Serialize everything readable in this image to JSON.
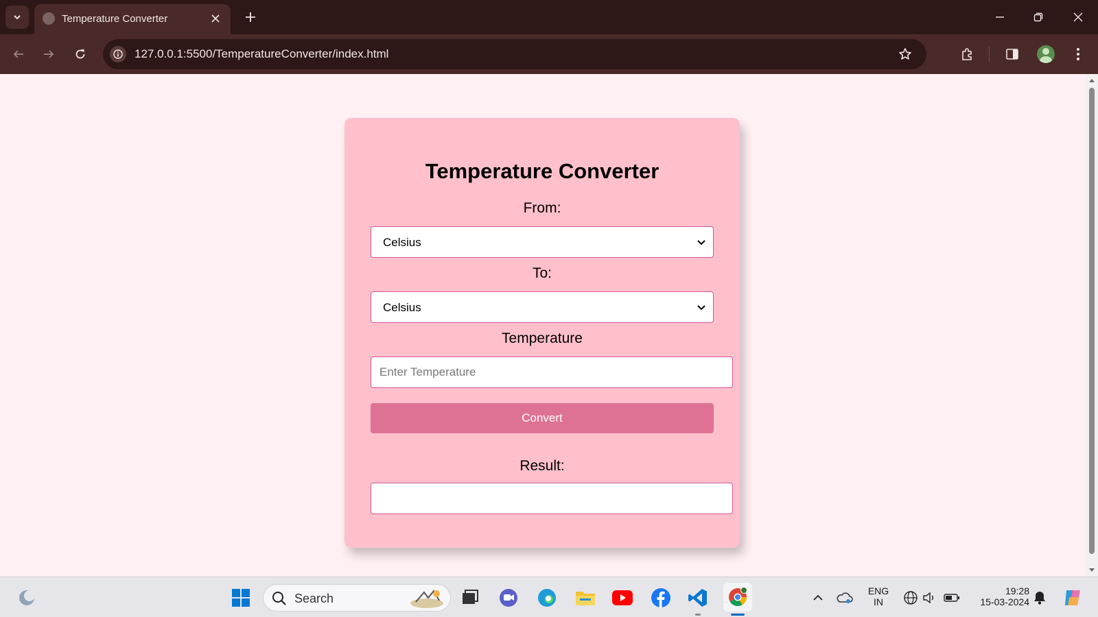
{
  "browser": {
    "tab_title": "Temperature Converter",
    "url": "127.0.0.1:5500/TemperatureConverter/index.html"
  },
  "page": {
    "title": "Temperature Converter",
    "from_label": "From:",
    "from_value": "Celsius",
    "to_label": "To:",
    "to_value": "Celsius",
    "temperature_label": "Temperature",
    "temperature_placeholder": "Enter Temperature",
    "temperature_value": "",
    "convert_label": "Convert",
    "result_label": "Result:",
    "result_value": ""
  },
  "taskbar": {
    "search_placeholder": "Search",
    "lang_line1": "ENG",
    "lang_line2": "IN",
    "time": "19:28",
    "date": "15-03-2024"
  },
  "colors": {
    "page_bg": "#fff0f4",
    "card_bg": "#ffc0cb",
    "input_border": "#d1569a",
    "button_bg": "#de7294",
    "chrome_dark": "#2e1817",
    "chrome_toolbar": "#4a2a28"
  },
  "icons": [
    "tab-search-icon",
    "globe-favicon-icon",
    "close-icon",
    "plus-icon",
    "minimize-icon",
    "restore-icon",
    "back-icon",
    "forward-icon",
    "reload-icon",
    "site-info-icon",
    "star-icon",
    "extensions-icon",
    "side-panel-icon",
    "profile-icon",
    "kebab-menu-icon",
    "chevron-down-icon",
    "windows-start-icon",
    "search-icon",
    "edge-icon",
    "chrome-icon",
    "vscode-icon",
    "youtube-icon",
    "facebook-icon",
    "folder-icon",
    "bell-icon",
    "wifi-icon",
    "volume-icon",
    "battery-icon"
  ]
}
